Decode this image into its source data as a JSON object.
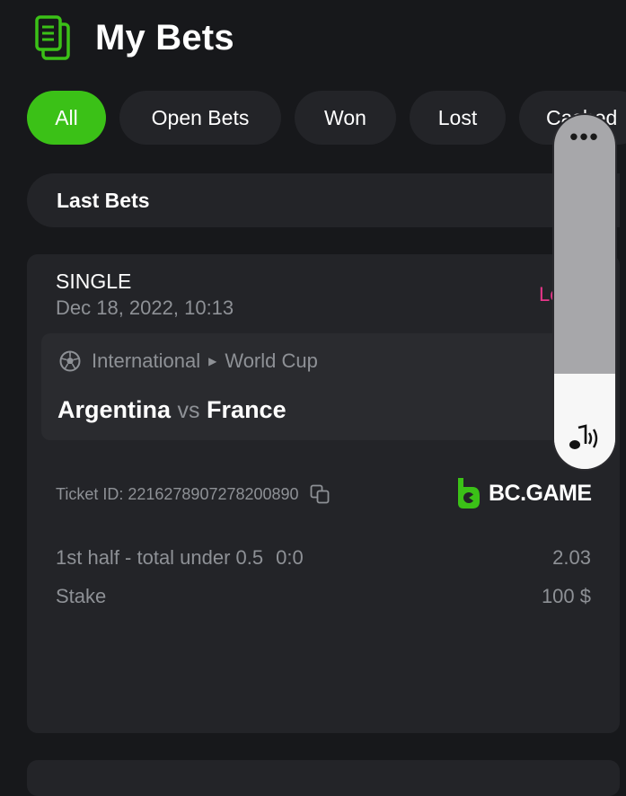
{
  "header": {
    "title": "My Bets",
    "icon": "document-stack-icon"
  },
  "tabs": [
    {
      "label": "All",
      "active": true
    },
    {
      "label": "Open Bets",
      "active": false
    },
    {
      "label": "Won",
      "active": false
    },
    {
      "label": "Lost",
      "active": false
    },
    {
      "label": "Cashed",
      "active": false
    }
  ],
  "filter": {
    "label": "Last Bets"
  },
  "bet": {
    "type": "SINGLE",
    "date": "Dec 18, 2022, 10:13",
    "status": "Lo",
    "category": "International",
    "league": "World Cup",
    "team_home": "Argentina",
    "vs": "vs",
    "team_away": "France",
    "ticket_label": "Ticket ID:",
    "ticket_id": "2216278907278200890",
    "brand": "BC.GAME",
    "market": "1st half - total under 0.5",
    "score": "0:0",
    "odds": "2.03",
    "stake_label": "Stake",
    "stake_value": "100 $"
  },
  "volume_overlay": {
    "menu": "•••",
    "level": 0.27
  },
  "colors": {
    "accent": "#3bc117",
    "lost": "#e8368a",
    "background": "#17181b",
    "card": "#232428"
  }
}
